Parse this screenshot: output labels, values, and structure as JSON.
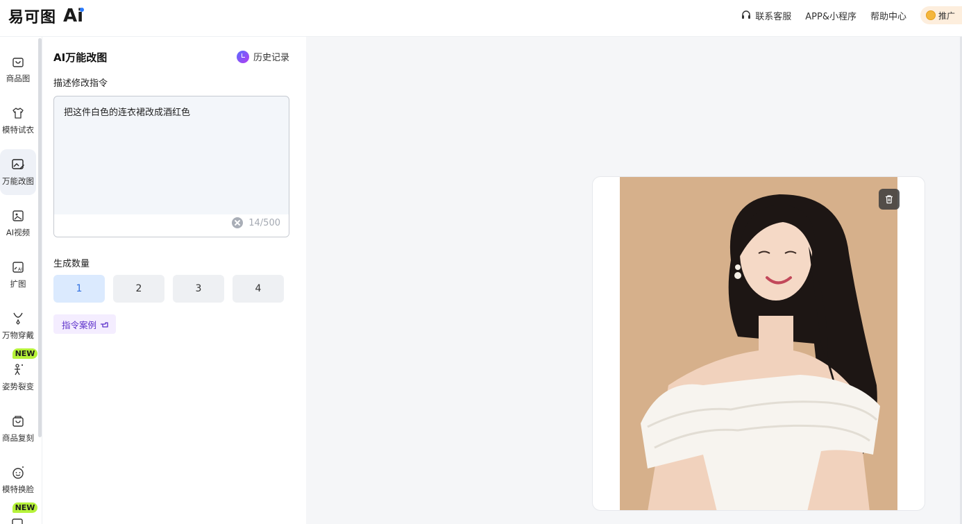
{
  "header": {
    "logo_text": "易可图",
    "logo_ai": "Ai",
    "nav": [
      {
        "label": "联系客服",
        "icon": "headset-icon"
      },
      {
        "label": "APP&小程序"
      },
      {
        "label": "帮助中心"
      }
    ],
    "promo_label": "推广"
  },
  "sidebar": {
    "items": [
      {
        "label": "商品图",
        "icon": "bag-icon"
      },
      {
        "label": "模特试衣",
        "icon": "shirt-icon"
      },
      {
        "label": "万能改图",
        "icon": "image-edit-icon",
        "active": true
      },
      {
        "label": "AI视频",
        "icon": "video-icon"
      },
      {
        "label": "扩图",
        "icon": "expand-icon"
      },
      {
        "label": "万物穿戴",
        "icon": "necklace-icon"
      },
      {
        "label": "姿势裂变",
        "icon": "pose-icon",
        "badge": "NEW"
      },
      {
        "label": "商品复刻",
        "icon": "copy-bag-icon"
      },
      {
        "label": "模特换脸",
        "icon": "face-icon"
      }
    ],
    "extra_badge": "NEW"
  },
  "panel": {
    "title": "AI万能改图",
    "history_label": "历史记录",
    "prompt_label": "描述修改指令",
    "prompt_value": "把这件白色的连衣裙改成酒红色",
    "prompt_counter": "14/500",
    "count_label": "生成数量",
    "count_options": [
      "1",
      "2",
      "3",
      "4"
    ],
    "count_selected": "1",
    "examples_label": "指令案例"
  },
  "colors": {
    "accent": "#2f6fe0",
    "new_badge": "#b6f23a",
    "photo_bg": "#d6b08b"
  }
}
